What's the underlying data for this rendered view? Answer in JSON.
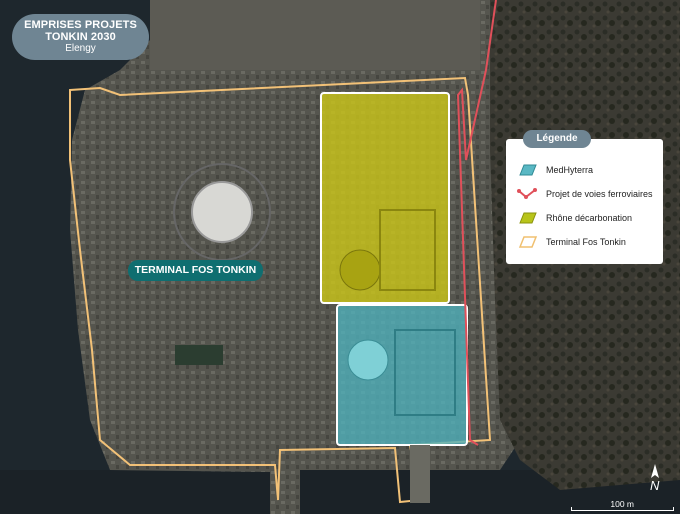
{
  "title_badge": {
    "line1": "EMPRISES PROJETS\nTONKIN 2030",
    "line1a": "EMPRISES PROJETS",
    "line1b": "TONKIN 2030",
    "line2": "Elengy"
  },
  "site_label": "TERMINAL FOS TONKIN",
  "legend": {
    "title": "Légende",
    "items": [
      {
        "label": "MedHyterra",
        "color": "#5ab8c4",
        "icon": "medhyterra-icon"
      },
      {
        "label": "Projet de voies ferroviaires",
        "color": "#e0505a",
        "icon": "rail-icon"
      },
      {
        "label": "Rhône décarbonation",
        "color": "#b8c41a",
        "icon": "rhone-icon"
      },
      {
        "label": "Terminal Fos Tonkin",
        "color": "#f0c070",
        "icon": "terminal-icon"
      }
    ]
  },
  "scale": {
    "label": "100 m"
  },
  "north": {
    "label": "N"
  },
  "colors": {
    "water": "#1c262c",
    "land": "#3a3a34",
    "rhone": "#c9c41a",
    "medhyterra": "#4fb2bd",
    "rail": "#e0505a",
    "boundary": "#f2c177"
  }
}
